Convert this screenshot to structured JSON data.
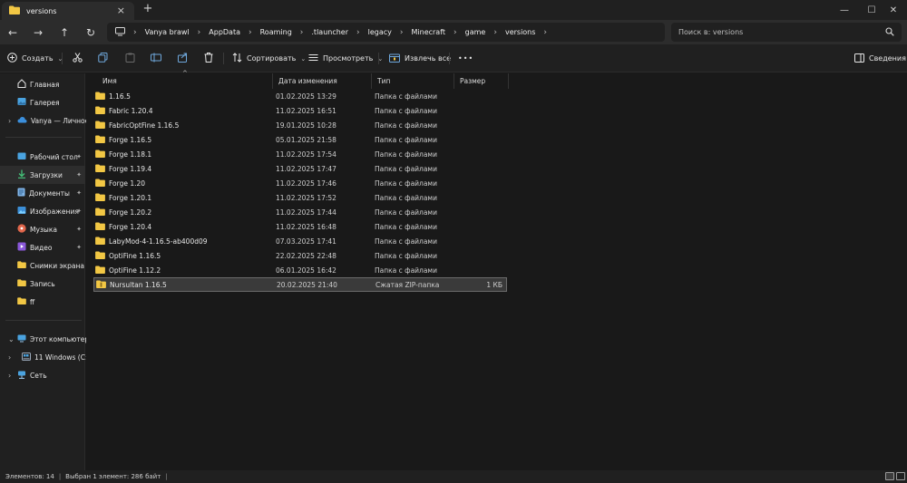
{
  "tab": {
    "title": "versions"
  },
  "window_controls": {
    "minimize": "—",
    "maximize": "☐",
    "close": "✕"
  },
  "nav": {
    "back": "←",
    "forward": "→",
    "up": "↑",
    "refresh": "↻"
  },
  "breadcrumb": [
    "Vanya brawl",
    "AppData",
    "Roaming",
    ".tlauncher",
    "legacy",
    "Minecraft",
    "game",
    "versions"
  ],
  "search": {
    "placeholder": "Поиск в: versions"
  },
  "toolbar": {
    "create": "Создать",
    "sort": "Сортировать",
    "view": "Просмотреть",
    "extract_all": "Извлечь все",
    "more": "•••",
    "details": "Сведения"
  },
  "sidebar": {
    "items": [
      {
        "label": "Главная",
        "icon": "home-icon"
      },
      {
        "label": "Галерея",
        "icon": "gallery-icon"
      },
      {
        "label": "Vanya — Личное",
        "icon": "cloud-icon"
      },
      {
        "label": "Рабочий стол",
        "icon": "desktop-icon"
      },
      {
        "label": "Загрузки",
        "icon": "download-icon"
      },
      {
        "label": "Документы",
        "icon": "documents-icon"
      },
      {
        "label": "Изображения",
        "icon": "pictures-icon"
      },
      {
        "label": "Музыка",
        "icon": "music-icon"
      },
      {
        "label": "Видео",
        "icon": "video-icon"
      },
      {
        "label": "Снимки экрана",
        "icon": "folder-icon"
      },
      {
        "label": "Запись",
        "icon": "folder-icon"
      },
      {
        "label": "ff",
        "icon": "folder-icon"
      },
      {
        "label": "Этот компьютер",
        "icon": "pc-icon"
      },
      {
        "label": "11 Windows (C:)",
        "icon": "drive-icon"
      },
      {
        "label": "Сеть",
        "icon": "network-icon"
      }
    ]
  },
  "columns": {
    "name": "Имя",
    "date": "Дата изменения",
    "type": "Тип",
    "size": "Размер"
  },
  "files": [
    {
      "name": "1.16.5",
      "date": "01.02.2025 13:29",
      "type": "Папка с файлами",
      "size": ""
    },
    {
      "name": "Fabric 1.20.4",
      "date": "11.02.2025 16:51",
      "type": "Папка с файлами",
      "size": ""
    },
    {
      "name": "FabricOptFine 1.16.5",
      "date": "19.01.2025 10:28",
      "type": "Папка с файлами",
      "size": ""
    },
    {
      "name": "Forge 1.16.5",
      "date": "05.01.2025 21:58",
      "type": "Папка с файлами",
      "size": ""
    },
    {
      "name": "Forge 1.18.1",
      "date": "11.02.2025 17:54",
      "type": "Папка с файлами",
      "size": ""
    },
    {
      "name": "Forge 1.19.4",
      "date": "11.02.2025 17:47",
      "type": "Папка с файлами",
      "size": ""
    },
    {
      "name": "Forge 1.20",
      "date": "11.02.2025 17:46",
      "type": "Папка с файлами",
      "size": ""
    },
    {
      "name": "Forge 1.20.1",
      "date": "11.02.2025 17:52",
      "type": "Папка с файлами",
      "size": ""
    },
    {
      "name": "Forge 1.20.2",
      "date": "11.02.2025 17:44",
      "type": "Папка с файлами",
      "size": ""
    },
    {
      "name": "Forge 1.20.4",
      "date": "11.02.2025 16:48",
      "type": "Папка с файлами",
      "size": ""
    },
    {
      "name": "LabyMod-4-1.16.5-ab400d09",
      "date": "07.03.2025 17:41",
      "type": "Папка с файлами",
      "size": ""
    },
    {
      "name": "OptiFine  1.16.5",
      "date": "22.02.2025 22:48",
      "type": "Папка с файлами",
      "size": ""
    },
    {
      "name": "OptiFine 1.12.2",
      "date": "06.01.2025 16:42",
      "type": "Папка с файлами",
      "size": ""
    },
    {
      "name": "Nursultan 1.16.5",
      "date": "20.02.2025 21:40",
      "type": "Сжатая ZIP-папка",
      "size": "1 КБ"
    }
  ],
  "status": {
    "count": "Элементов: 14",
    "selected": "Выбран 1 элемент: 286 байт",
    "bar": "|"
  },
  "colors": {
    "folder": "#f2c744",
    "accent": "#4aa3e0",
    "background": "#191919",
    "panel": "#202020"
  }
}
